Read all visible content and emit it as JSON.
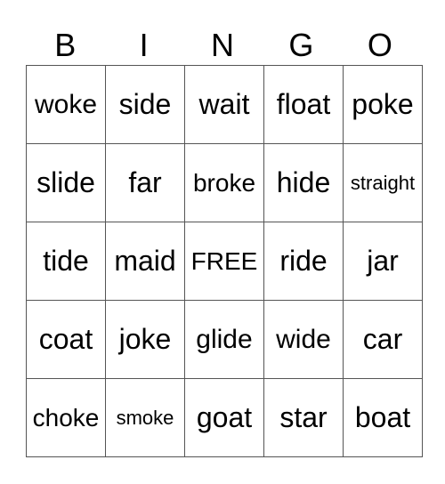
{
  "header": [
    "B",
    "I",
    "N",
    "G",
    "O"
  ],
  "rows": [
    [
      "woke",
      "side",
      "wait",
      "float",
      "poke"
    ],
    [
      "slide",
      "far",
      "broke",
      "hide",
      "straight"
    ],
    [
      "tide",
      "maid",
      "FREE",
      "ride",
      "jar"
    ],
    [
      "coat",
      "joke",
      "glide",
      "wide",
      "car"
    ],
    [
      "choke",
      "smoke",
      "goat",
      "star",
      "boat"
    ]
  ]
}
